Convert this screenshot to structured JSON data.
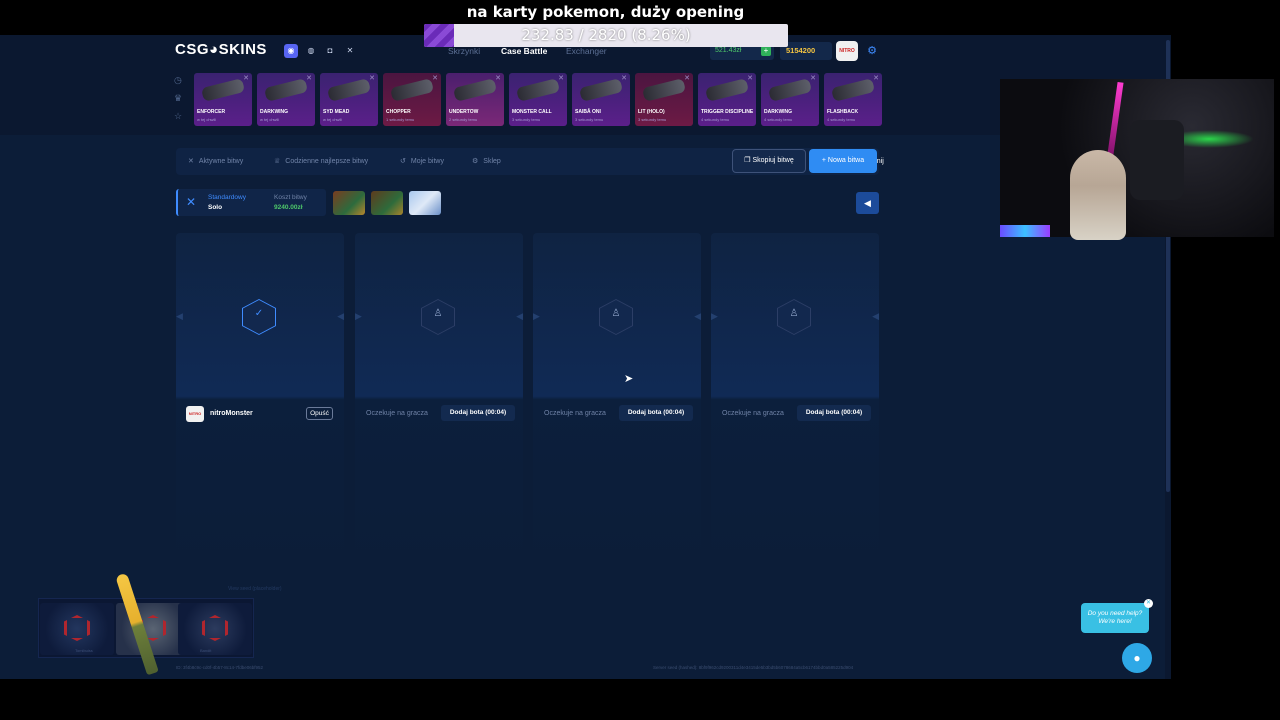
{
  "stream": {
    "title": "na karty pokemon, duży opening",
    "goal_text": "232.83 / 2820 (8.26%)",
    "goal_fraction": 0.0826
  },
  "header": {
    "logo": "CSG◕SKINS",
    "social_icons": [
      "discord-icon",
      "facebook-icon",
      "instagram-icon",
      "x-icon"
    ],
    "nav": [
      "Skrzynki",
      "Case Battle",
      "Exchanger"
    ],
    "balance": "521.43zł",
    "coins": "5154200",
    "avatar_label": "NITRO"
  },
  "drops": [
    {
      "name": "ENFORCER",
      "sub": "w tej chwili",
      "color": "purple"
    },
    {
      "name": "DARKWING",
      "sub": "w tej chwili",
      "color": "purple"
    },
    {
      "name": "SYD MEAD",
      "sub": "w tej chwili",
      "color": "purple"
    },
    {
      "name": "CHOPPER",
      "sub": "1 sekundy temu",
      "color": "red"
    },
    {
      "name": "UNDERTOW",
      "sub": "2 sekundy temu",
      "color": "pink"
    },
    {
      "name": "MONSTER CALL",
      "sub": "3 sekundy temu",
      "color": "purple"
    },
    {
      "name": "SAIBĀ ONI",
      "sub": "3 sekundy temu",
      "color": "purple"
    },
    {
      "name": "LIT (HOLO)",
      "sub": "3 sekundy temu",
      "color": "red"
    },
    {
      "name": "TRIGGER DISCIPLINE",
      "sub": "4 sekundy temu",
      "color": "purple"
    },
    {
      "name": "DARKWING",
      "sub": "4 sekundy temu",
      "color": "purple"
    },
    {
      "name": "FLASHBACK",
      "sub": "4 sekundy temu",
      "color": "purple"
    }
  ],
  "tabs": {
    "active": "Aktywne bitwy",
    "daily": "Codzienne najlepsze bitwy",
    "mine": "Moje bitwy",
    "shop": "Sklep",
    "share": "Udostępnij",
    "copy": "Skopiuj bitwę",
    "new": "+ Nowa bitwa"
  },
  "mode": {
    "type": "Standardowy",
    "sub": "Solo",
    "cost_label": "Koszt bitwy",
    "cost_value": "9240.00zł"
  },
  "slots": {
    "player_name": "nitroMonster",
    "player_avatar": "NITRO",
    "leave": "Opuść",
    "waiting": "Oczekuje na gracza",
    "add_bot": "Dodaj bota (00:04)"
  },
  "footer": {
    "faded": "View seed (placeholder)",
    "id": "ID: 3f4b8c9c-cd0f-4b57-8c14-7fdbe06bf952",
    "seed": "Server seed (hashed): 8bf9f962cd9200311d4e3415de5b3bd5b6078684a5cb6174bbd0a585225d904"
  },
  "help": {
    "bubble": "Do you need help? We're here!"
  },
  "widget": {
    "labels": [
      "Tomibuiss",
      "",
      "Bandit"
    ]
  }
}
